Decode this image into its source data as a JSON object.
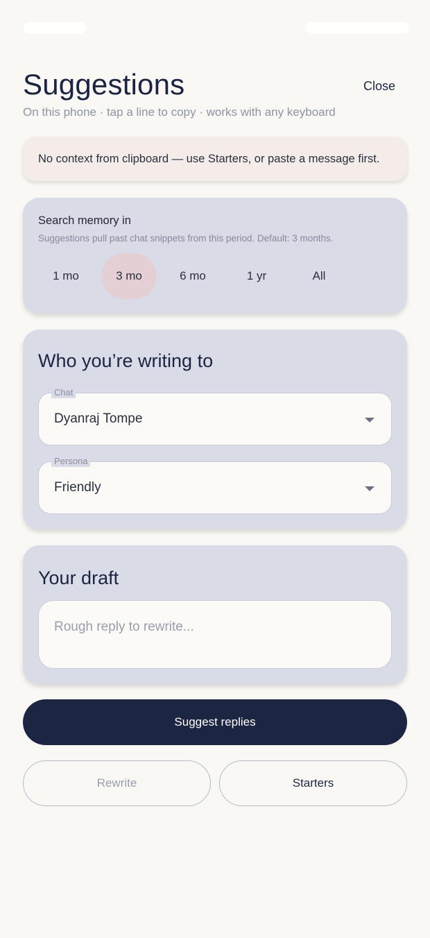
{
  "header": {
    "title": "Suggestions",
    "close_label": "Close",
    "subtitle": "On this phone · tap a line to copy · works with any keyboard"
  },
  "notice": {
    "text": "No context from clipboard — use Starters, or paste a message first."
  },
  "memory": {
    "label": "Search memory in",
    "help": "Suggestions pull past chat snippets from this period. Default: 3 months.",
    "options": [
      "1 mo",
      "3 mo",
      "6 mo",
      "1 yr",
      "All"
    ],
    "selected": "3 mo"
  },
  "recipient": {
    "title": "Who you’re writing to",
    "chat_label": "Chat",
    "chat_value": "Dyanraj Tompe",
    "persona_label": "Persona",
    "persona_value": "Friendly"
  },
  "draft": {
    "title": "Your draft",
    "placeholder": "Rough reply to rewrite..."
  },
  "actions": {
    "suggest_label": "Suggest replies",
    "rewrite_label": "Rewrite",
    "starters_label": "Starters"
  },
  "colors": {
    "background": "#f9f8f5",
    "primary": "#1c2541",
    "card": "#d9dbe7",
    "selected_chip": "#e3cfd4",
    "notice": "#f3ece8"
  }
}
